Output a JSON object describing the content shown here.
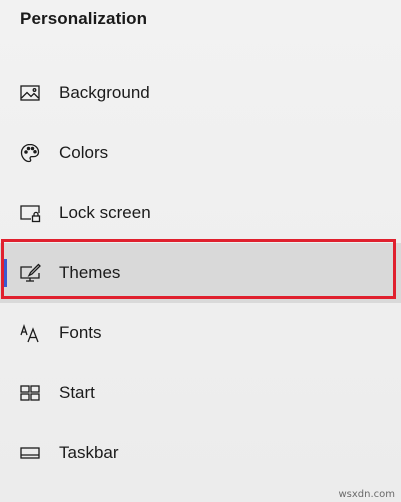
{
  "header": {
    "title": "Personalization"
  },
  "menu": {
    "items": [
      {
        "label": "Background",
        "icon": "picture-icon",
        "selected": false
      },
      {
        "label": "Colors",
        "icon": "palette-icon",
        "selected": false
      },
      {
        "label": "Lock screen",
        "icon": "lock-screen-icon",
        "selected": false
      },
      {
        "label": "Themes",
        "icon": "brush-monitor-icon",
        "selected": true
      },
      {
        "label": "Fonts",
        "icon": "fonts-icon",
        "selected": false
      },
      {
        "label": "Start",
        "icon": "start-tiles-icon",
        "selected": false
      },
      {
        "label": "Taskbar",
        "icon": "taskbar-icon",
        "selected": false
      }
    ]
  },
  "accent_color": "#3a5ad0",
  "highlight_color": "#e0202e",
  "watermark": "wsxdn.com"
}
